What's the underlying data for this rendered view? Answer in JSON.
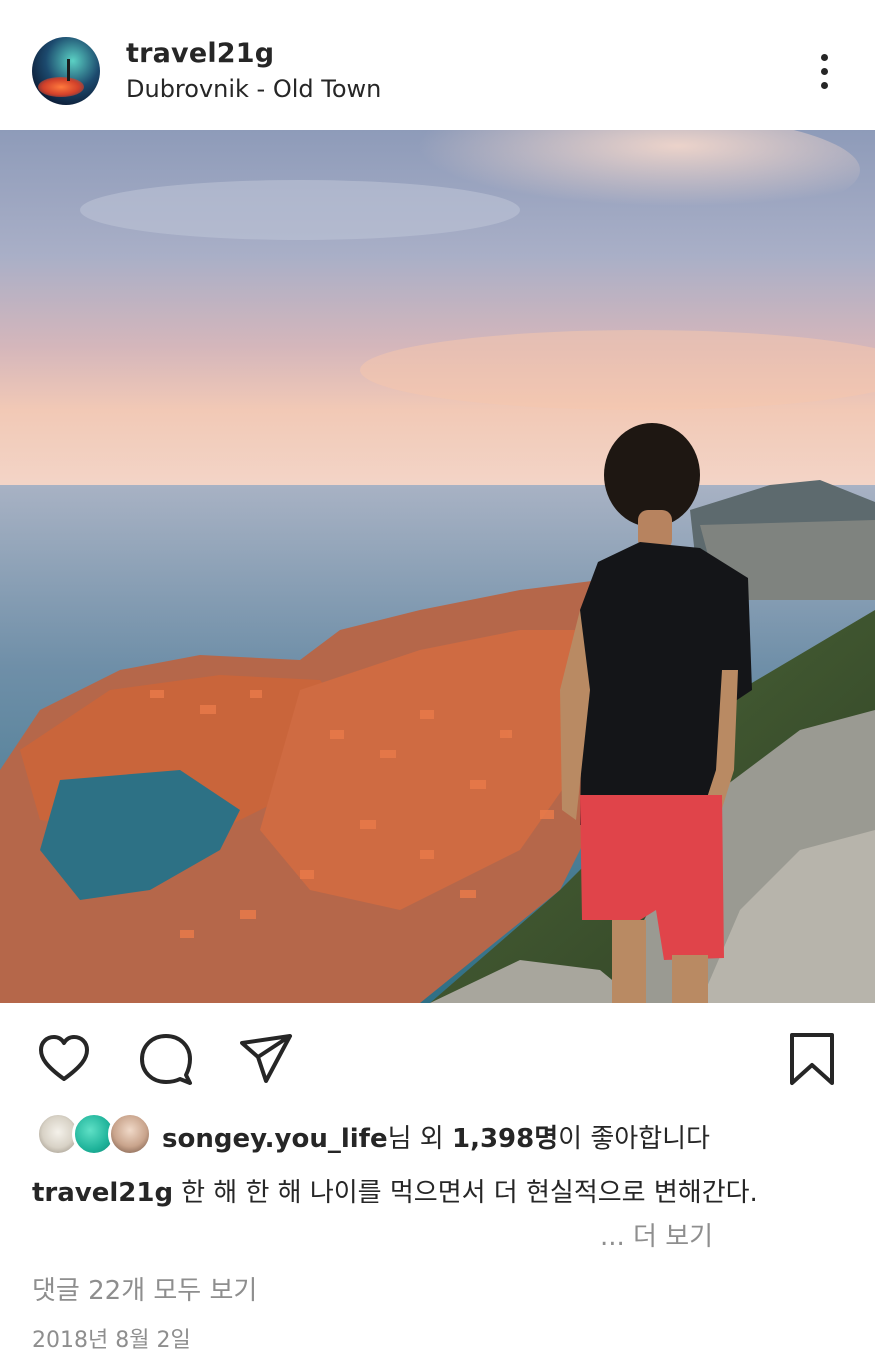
{
  "post": {
    "username": "travel21g",
    "location": "Dubrovnik - Old Town"
  },
  "icons": {
    "more": "more-vertical-icon",
    "like": "heart-icon",
    "comment": "comment-bubble-icon",
    "share": "paper-plane-icon",
    "save": "bookmark-icon"
  },
  "likes": {
    "user": "songey.you_life",
    "suffix_1": "님 외 ",
    "count": "1,398명",
    "suffix_2": "이 좋아합니다"
  },
  "caption": {
    "user": "travel21g",
    "text": "한 해 한 해 나이를 먹으면서 더 현실적으로 변해간다.",
    "more": "... 더 보기"
  },
  "comments_link": "댓글 22개 모두 보기",
  "date": "2018년 8월 2일",
  "colors": {
    "text": "#262626",
    "secondary": "#8e8e8e",
    "background": "#ffffff"
  }
}
